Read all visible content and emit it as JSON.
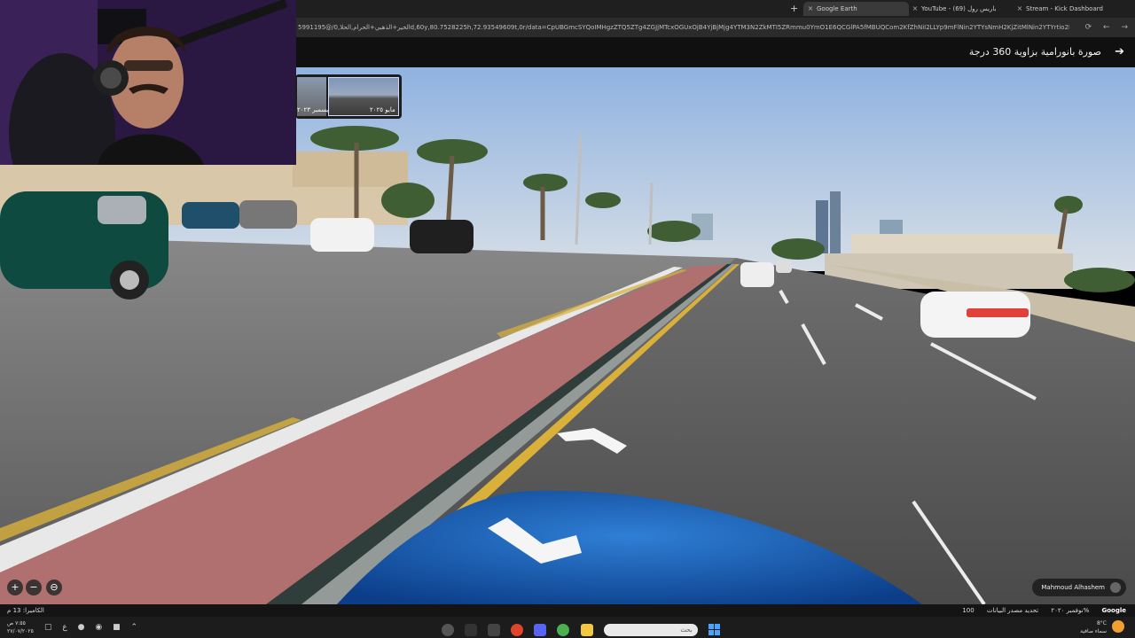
{
  "browser": {
    "tabs": [
      {
        "label": "Google Earth",
        "active": true
      },
      {
        "label": "YouTube - باريس رول (69)",
        "active": false
      },
      {
        "label": "Stream - Kick Dashboard",
        "active": false
      }
    ],
    "url": "5991195@/الخير+الذهبي+الحرام,الحلا,0d,60y,80.7528225h,72.93549609t,0r/data=CpUBGmcSYQoIMHgzZTQ5ZTg4ZGJjMTcxOGUxOjB4YjBjMjg4YTM3N2ZkMTI5ZRmmu0YmO1E6QCGlPA5fMBUQCom2KfZhNiI2LLYp9mFlNin2YTYsNmH2KjZitMlNin2YTYrtio2LEYASABIiYWDwGNMU4..."
  },
  "header": {
    "title": "صورة بانورامية بزاوية 360 درجة"
  },
  "thumbnails": {
    "dates": [
      "ديسمبر ٢٠٢٣",
      "مايو ٢٠٢٥"
    ]
  },
  "attribution": {
    "author": "Mahmoud Alhashem"
  },
  "zoom_controls": {
    "plus": "+",
    "minus": "−"
  },
  "status_bar": {
    "camera": "الكاميرا: 13 م",
    "zoom": "100%",
    "data_source": "تحديد مصدر البيانات",
    "date": "نوفمبر ٢٠٢٠",
    "logo": "Google"
  },
  "taskbar": {
    "clock_time": "٧:٥٥ ص",
    "clock_date": "٢٧/٠٧/٢٠٢٥",
    "search_placeholder": "بحث",
    "lang": "ع",
    "weather_temp": "8°C",
    "weather_desc": "سماء صافية"
  }
}
